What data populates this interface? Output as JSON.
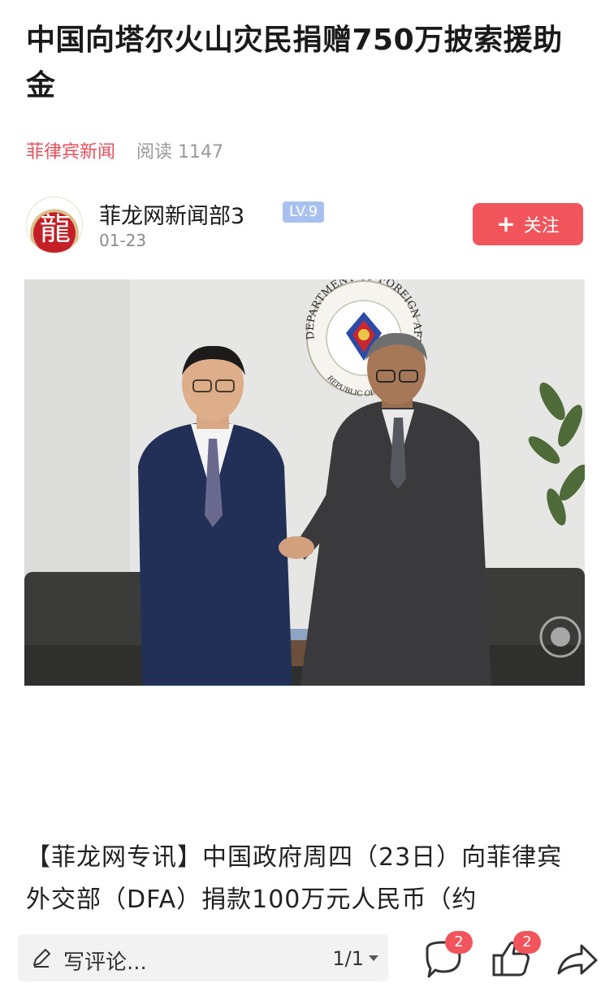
{
  "article": {
    "title": "中国向塔尔火山灾民捐赠750万披索援助金",
    "source": "菲律宾新闻",
    "reads": "阅读 1147"
  },
  "author": {
    "name": "菲龙网新闻部3",
    "level": "LV.9",
    "date": "01-23",
    "avatar_glyph": "龍"
  },
  "follow": {
    "plus": "+",
    "label": "关注"
  },
  "photo": {
    "seal_top_text": "DEPARTMENT OF FOREIGN AFFAIRS",
    "seal_bottom_text": "REPUBLIC OF THE PHILIPPINES"
  },
  "body": {
    "text": "【菲龙网专讯】中国政府周四（23日）向菲律宾外交部（DFA）捐款100万元人民币（约"
  },
  "bottom_bar": {
    "comment_placeholder": "写评论...",
    "page_indicator": "1/1",
    "comment_count": "2",
    "like_count": "2"
  },
  "colors": {
    "accent": "#f2545b",
    "source_red": "#e8505b",
    "level_badge": "#a8c1ee",
    "muted": "#9a9a9a"
  },
  "icons": [
    "pen-icon",
    "comment-icon",
    "thumbs-up-icon",
    "share-icon",
    "dropdown-caret-icon",
    "plus-icon"
  ]
}
